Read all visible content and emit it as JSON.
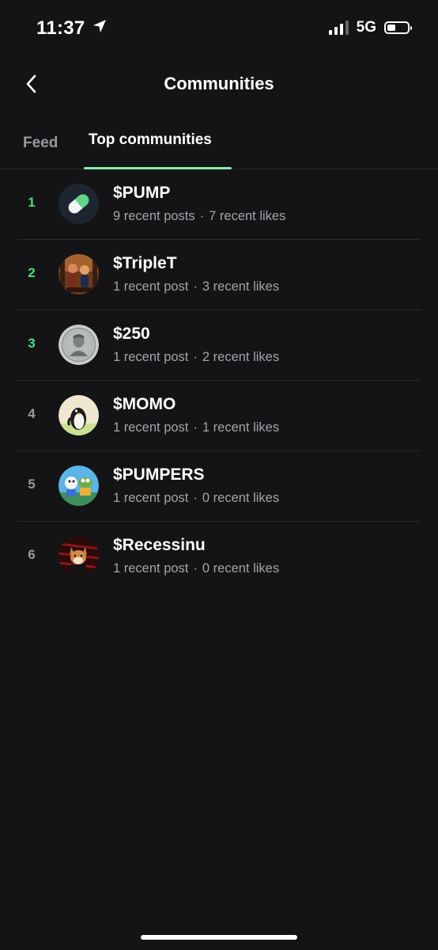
{
  "status_bar": {
    "time": "11:37",
    "network": "5G",
    "location_icon": "location-arrow-icon",
    "signal_icon": "cellular-signal-icon",
    "battery_icon": "battery-icon",
    "battery_level": 0.4
  },
  "header": {
    "back_icon": "chevron-left-icon",
    "title": "Communities"
  },
  "tabs": [
    {
      "label": "Feed",
      "active": false
    },
    {
      "label": "Top communities",
      "active": true
    }
  ],
  "accent_color": "#4ade80",
  "communities": [
    {
      "rank": "1",
      "name": "$PUMP",
      "posts": "9 recent posts",
      "likes": "7 recent likes",
      "avatar": "pill-icon"
    },
    {
      "rank": "2",
      "name": "$TripleT",
      "posts": "1 recent post",
      "likes": "3 recent likes",
      "avatar": "triplet-avatar"
    },
    {
      "rank": "3",
      "name": "$250",
      "posts": "1 recent post",
      "likes": "2 recent likes",
      "avatar": "coin-portrait-avatar"
    },
    {
      "rank": "4",
      "name": "$MOMO",
      "posts": "1 recent post",
      "likes": "1 recent likes",
      "avatar": "penguin-avatar"
    },
    {
      "rank": "5",
      "name": "$PUMPERS",
      "posts": "1 recent post",
      "likes": "0 recent likes",
      "avatar": "frog-characters-avatar"
    },
    {
      "rank": "6",
      "name": "$Recessinu",
      "posts": "1 recent post",
      "likes": "0 recent likes",
      "avatar": "shiba-dog-avatar"
    }
  ]
}
